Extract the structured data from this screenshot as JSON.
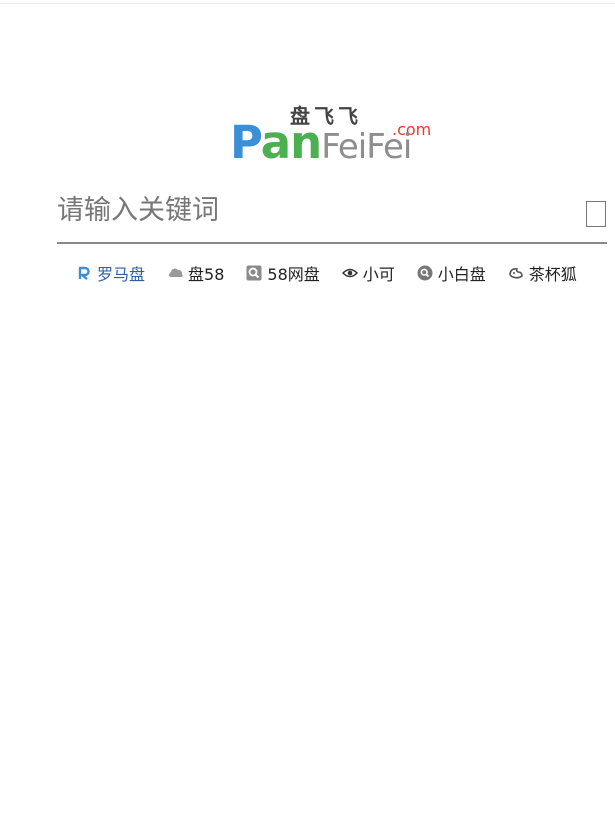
{
  "logo": {
    "chinese": "盘飞飞",
    "p": "P",
    "an": "an",
    "fei1": "Fei",
    "fei2": "Fei",
    "dotcom": ".com"
  },
  "search": {
    "placeholder": "请输入关键词",
    "value": ""
  },
  "sources": [
    {
      "label": "罗马盘",
      "icon": "roma-r-icon",
      "active": true
    },
    {
      "label": "盘58",
      "icon": "cloud-icon",
      "active": false
    },
    {
      "label": "58网盘",
      "icon": "square-search-icon",
      "active": false
    },
    {
      "label": "小可",
      "icon": "eye-icon",
      "active": false
    },
    {
      "label": "小白盘",
      "icon": "circle-search-icon",
      "active": false
    },
    {
      "label": "茶杯狐",
      "icon": "fox-icon",
      "active": false
    }
  ],
  "colors": {
    "logo_blue": "#3b8fd9",
    "logo_green": "#4caf50",
    "logo_gray": "#8e8e8e",
    "logo_red": "#e53935",
    "active_source": "#2e5ea8"
  }
}
